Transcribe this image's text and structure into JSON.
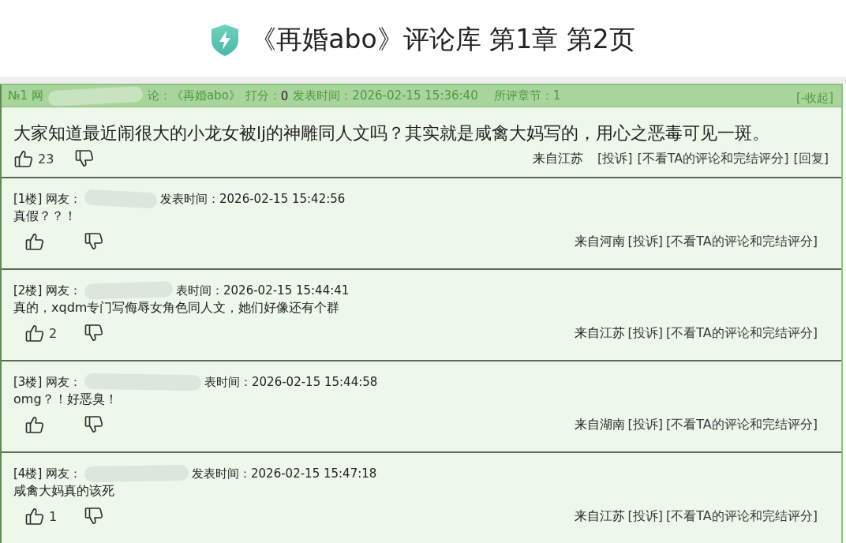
{
  "page_title": "《再婚abo》评论库 第1章 第2页",
  "main_comment": {
    "header": {
      "number": "№1 网",
      "redacted": true,
      "work": "论：《再婚abo》",
      "score_label": "打分：",
      "score": "0",
      "posted": "发表时间：2026-02-15 15:36:40",
      "chapter": "所评章节：1",
      "collapse": "[-收起]"
    },
    "body": "大家知道最近闹很大的小龙女被lj的神雕同人文吗？其实就是咸禽大妈写的，用心之恶毒可见一斑。",
    "likes": "23",
    "location": "来自江苏",
    "actions": [
      "[投诉]",
      "[不看TA的评论和完结评分]",
      "[回复]"
    ]
  },
  "replies": [
    {
      "floor": "[1楼] 网友：",
      "redacted": true,
      "posted": "发表时间：2026-02-15 15:42:56",
      "body": "真假？？！",
      "location": "来自河南",
      "actions": [
        "[投诉]",
        "[不看TA的评论和完结评分]"
      ]
    },
    {
      "floor": "[2楼] 网友：",
      "redacted": true,
      "posted": "表时间：2026-02-15 15:44:41",
      "body": "真的，xqdm专门写侮辱女角色同人文，她们好像还有个群",
      "likes": "2",
      "location": "来自江苏",
      "actions": [
        "[投诉]",
        "[不看TA的评论和完结评分]"
      ]
    },
    {
      "floor": "[3楼] 网友：",
      "redacted": true,
      "posted": "表时间：2026-02-15 15:44:58",
      "body": "omg？！好恶臭！",
      "location": "来自湖南",
      "actions": [
        "[投诉]",
        "[不看TA的评论和完结评分]"
      ]
    },
    {
      "floor": "[4楼] 网友：",
      "redacted": true,
      "posted": "发表时间：2026-02-15 15:47:18",
      "body": "咸禽大妈真的该死",
      "likes": "1",
      "location": "来自江苏",
      "actions": [
        "[投诉]",
        "[不看TA的评论和完结评分]"
      ]
    }
  ]
}
